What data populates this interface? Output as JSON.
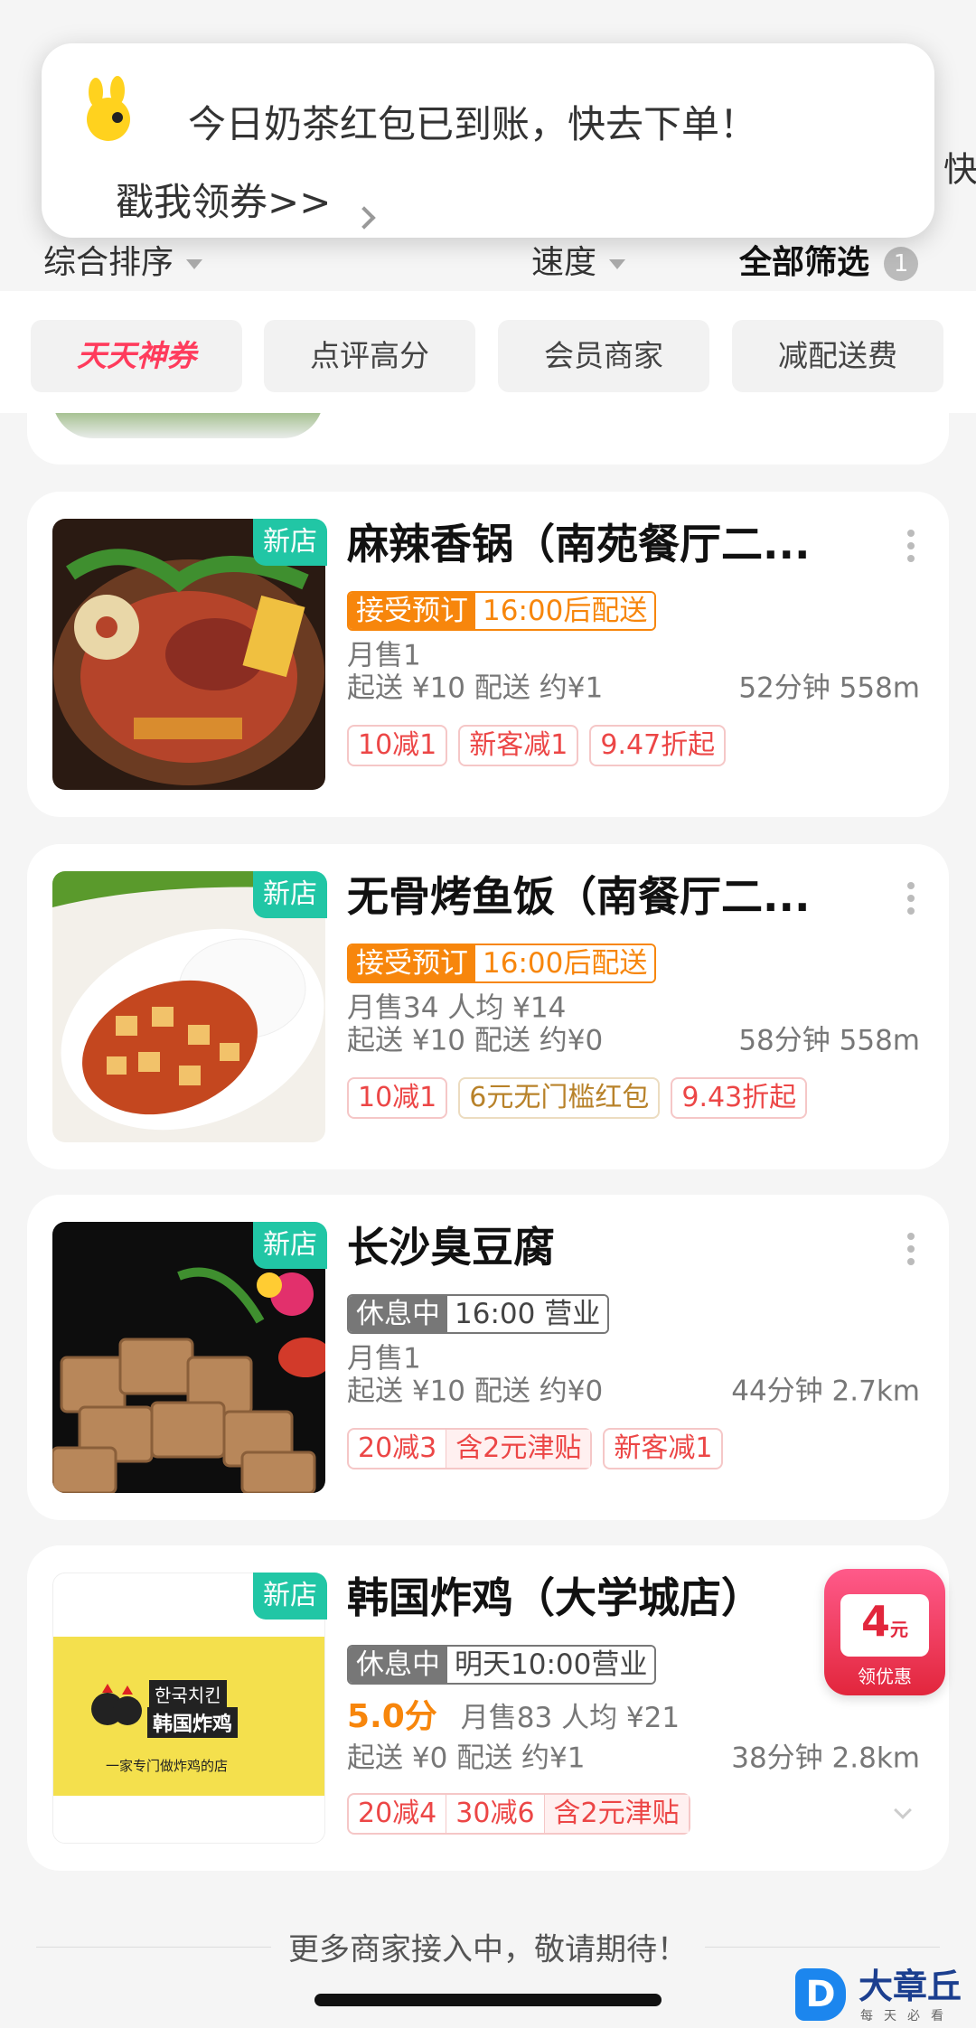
{
  "toast": {
    "message": "今日奶茶红包已到账，快去下单！",
    "link": "戳我领券>>",
    "peek_text": "快"
  },
  "sort_bar": {
    "default_sort": "综合排序",
    "speed": "速度",
    "all_filter": "全部筛选",
    "filter_count": "1"
  },
  "chips": [
    "天天神券",
    "点评高分",
    "会员商家",
    "减配送费"
  ],
  "shops": [
    {
      "new_tag": "新店",
      "name": "麻辣香锅（南苑餐厅二...",
      "status_label": "接受预订",
      "status_time": "16:00后配送",
      "sales": "月售1",
      "delivery": "起送 ¥10   配送 约¥1",
      "time_distance": "52分钟 558m",
      "promos": [
        "10减1",
        "新客减1",
        "9.47折起"
      ]
    },
    {
      "new_tag": "新店",
      "name": "无骨烤鱼饭（南餐厅二...",
      "status_label": "接受预订",
      "status_time": "16:00后配送",
      "sales": "月售34   人均 ¥14",
      "delivery": "起送 ¥10   配送 约¥0",
      "time_distance": "58分钟 558m",
      "promos": [
        "10减1",
        "6元无门槛红包",
        "9.43折起"
      ]
    },
    {
      "new_tag": "新店",
      "name": "长沙臭豆腐",
      "status_label": "休息中",
      "status_time": "16:00 营业",
      "sales": "月售1",
      "delivery": "起送 ¥10   配送 约¥0",
      "time_distance": "44分钟 2.7km",
      "promo_split": [
        "20减3",
        "含2元津贴"
      ],
      "promos": [
        "新客减1"
      ]
    },
    {
      "new_tag": "新店",
      "name": "韩国炸鸡（大学城店）",
      "status_label": "休息中",
      "status_time": "明天10:00营业",
      "score": "5.0分",
      "sales": "月售83   人均 ¥21",
      "delivery": "起送 ¥0   配送 约¥1",
      "time_distance": "38分钟 2.8km",
      "promo_split": [
        "20减4",
        "30减6",
        "含2元津贴"
      ],
      "logo_korean": "한국치킨",
      "logo_cn": "韩国炸鸡",
      "slogan": "一家专门做炸鸡的店"
    }
  ],
  "floating_coupon": {
    "amount": "4",
    "unit": "元",
    "label": "领优惠"
  },
  "footer": {
    "text": "更多商家接入中，敬请期待！"
  },
  "watermark": {
    "letter": "D",
    "title": "大章丘",
    "sub": "每天必看"
  },
  "colors": {
    "accent_orange": "#f7860c",
    "new_tag": "#21c6a5",
    "promo_red": "#ec4646",
    "hot_chip": "#ff3b5c"
  }
}
